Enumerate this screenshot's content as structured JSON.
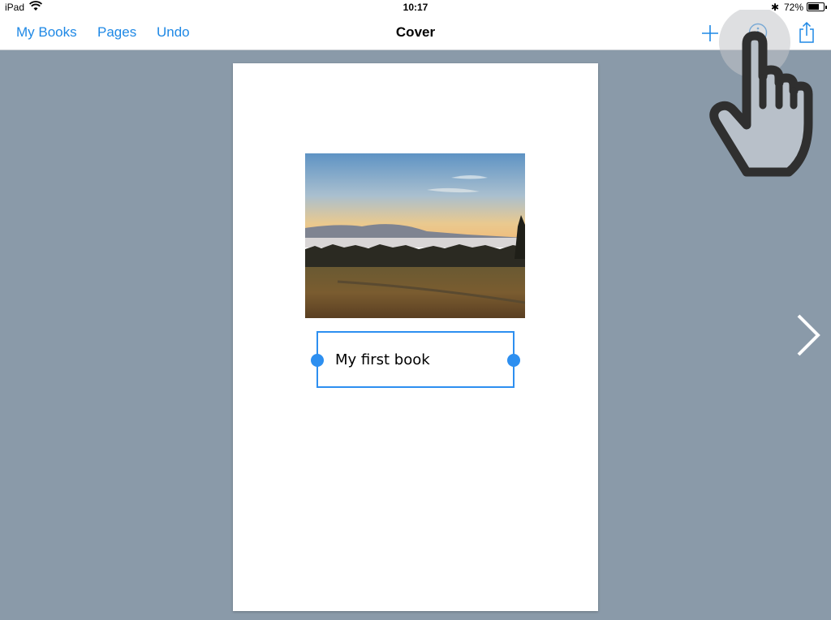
{
  "status_bar": {
    "device": "iPad",
    "time": "10:17",
    "battery_pct": "72%",
    "battery_level": 0.72
  },
  "nav": {
    "my_books": "My Books",
    "pages": "Pages",
    "undo": "Undo",
    "title": "Cover",
    "icons": [
      "plus-icon",
      "info-icon",
      "share-icon"
    ]
  },
  "page": {
    "title_text": "My first book"
  },
  "colors": {
    "accent": "#1e88e5",
    "selection": "#2d8ff0",
    "background": "#8a9aa9"
  }
}
